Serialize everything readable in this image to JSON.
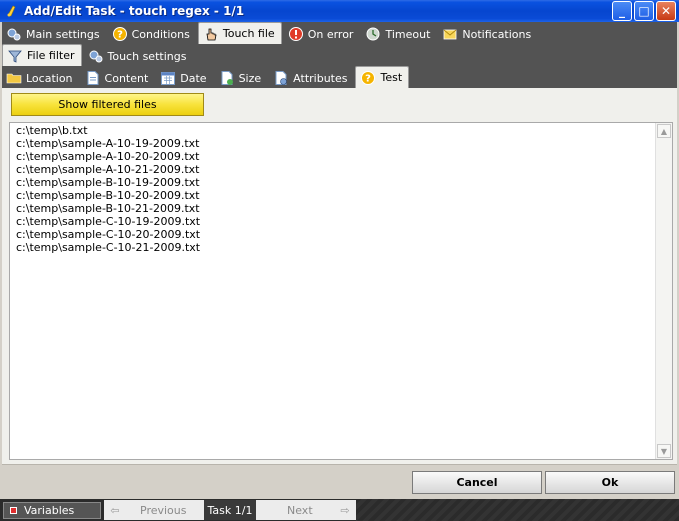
{
  "window": {
    "title": "Add/Edit Task - touch regex - 1/1",
    "minimize_label": "_",
    "maximize_label": "□",
    "close_label": "✕"
  },
  "main_tabs": [
    {
      "label": "Main settings",
      "icon": "gears-icon"
    },
    {
      "label": "Conditions",
      "icon": "question-icon"
    },
    {
      "label": "Touch file",
      "icon": "hand-icon"
    },
    {
      "label": "On error",
      "icon": "error-icon"
    },
    {
      "label": "Timeout",
      "icon": "clock-icon"
    },
    {
      "label": "Notifications",
      "icon": "envelope-icon"
    }
  ],
  "sub_tabs": [
    {
      "label": "File filter",
      "icon": "filter-icon"
    },
    {
      "label": "Touch settings",
      "icon": "gears-icon"
    }
  ],
  "filter_tabs": [
    {
      "label": "Location",
      "icon": "folder-icon"
    },
    {
      "label": "Content",
      "icon": "document-icon"
    },
    {
      "label": "Date",
      "icon": "calendar-icon"
    },
    {
      "label": "Size",
      "icon": "size-icon"
    },
    {
      "label": "Attributes",
      "icon": "attributes-icon"
    },
    {
      "label": "Test",
      "icon": "question-icon"
    }
  ],
  "panel": {
    "show_button_label": "Show filtered files",
    "files": [
      "c:\\temp\\b.txt",
      "c:\\temp\\sample-A-10-19-2009.txt",
      "c:\\temp\\sample-A-10-20-2009.txt",
      "c:\\temp\\sample-A-10-21-2009.txt",
      "c:\\temp\\sample-B-10-19-2009.txt",
      "c:\\temp\\sample-B-10-20-2009.txt",
      "c:\\temp\\sample-B-10-21-2009.txt",
      "c:\\temp\\sample-C-10-19-2009.txt",
      "c:\\temp\\sample-C-10-20-2009.txt",
      "c:\\temp\\sample-C-10-21-2009.txt"
    ]
  },
  "buttons": {
    "cancel": "Cancel",
    "ok": "Ok"
  },
  "statusbar": {
    "variables": "Variables",
    "previous": "Previous",
    "task_counter": "Task 1/1",
    "next": "Next"
  },
  "colors": {
    "titlebar": "#0a4bd6",
    "tab_bar": "#535353",
    "show_button": "#f8e33b"
  }
}
